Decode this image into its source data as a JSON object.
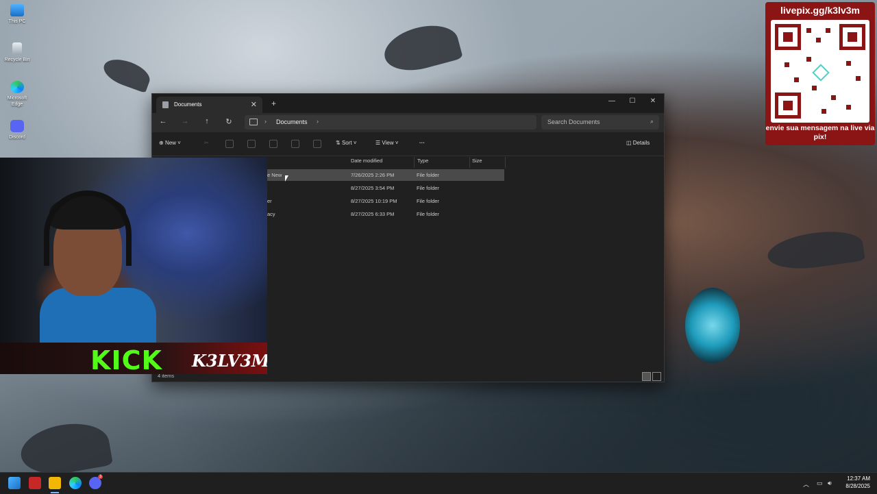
{
  "desktop": {
    "icons": [
      {
        "label": "This PC",
        "icon": "monitor-icon"
      },
      {
        "label": "Recycle Bin",
        "icon": "recycle-bin-icon"
      },
      {
        "label": "Microsoft Edge",
        "icon": "edge-icon"
      },
      {
        "label": "Discord",
        "icon": "discord-icon"
      }
    ]
  },
  "explorer": {
    "tab_title": "Documents",
    "new_tab_symbol": "+",
    "close_symbol": "✕",
    "window_controls": {
      "minimize": "—",
      "maximize": "☐",
      "close": "✕"
    },
    "nav": {
      "back": "←",
      "forward": "→",
      "up": "↑",
      "refresh": "↻"
    },
    "address": {
      "crumb": "Documents",
      "sep": "›"
    },
    "search_placeholder": "Search Documents",
    "toolbar": {
      "new_label": "New",
      "sort_label": "Sort",
      "view_label": "View",
      "more_label": "···",
      "details_label": "Details"
    },
    "columns": {
      "date": "Date modified",
      "type": "Type",
      "size": "Size"
    },
    "rows": [
      {
        "name": "e New",
        "date": "7/26/2025 2:26 PM",
        "type": "File folder",
        "selected": true
      },
      {
        "name": "",
        "date": "8/27/2025 3:54 PM",
        "type": "File folder"
      },
      {
        "name": "er",
        "date": "8/27/2025 10:19 PM",
        "type": "File folder"
      },
      {
        "name": "acy",
        "date": "8/27/2025 6:33 PM",
        "type": "File folder"
      }
    ],
    "status": "4 items"
  },
  "stream_overlay": {
    "kick_text": "KICK",
    "channel_text": "K3LV3M",
    "pix_url": "livepix.gg/k3lv3m",
    "pix_message": "envie sua mensagem na live via pix!",
    "accent_color": "#8b1414",
    "kick_color": "#53fc18"
  },
  "taskbar": {
    "apps": [
      "start-icon",
      "video-app-icon",
      "file-explorer-icon",
      "edge-icon",
      "discord-icon"
    ],
    "discord_badge": "3",
    "time": "12:37 AM",
    "date": "8/28/2025"
  }
}
